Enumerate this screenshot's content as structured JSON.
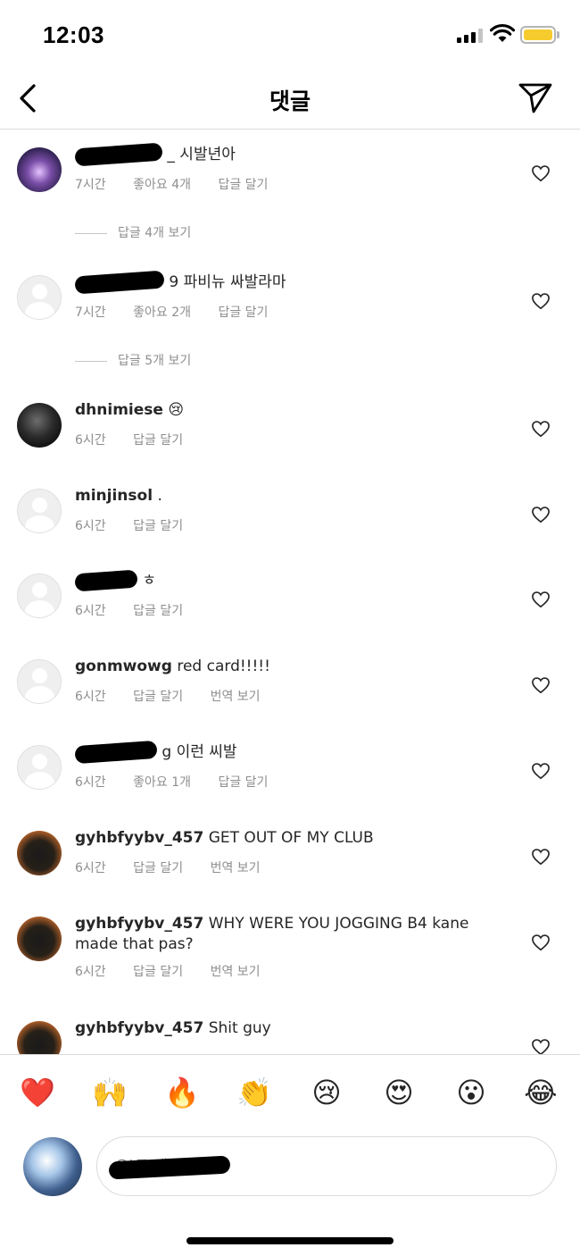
{
  "status_bar": {
    "time": "12:03"
  },
  "header": {
    "title": "댓글"
  },
  "comments": [
    {
      "text": "_ 시발년아",
      "meta": [
        "7시간",
        "좋아요 4개",
        "답글 달기"
      ]
    },
    {
      "replies": "답글 4개 보기"
    },
    {
      "text": "9 파비뉴 싸발라마",
      "meta": [
        "7시간",
        "좋아요 2개",
        "답글 달기"
      ]
    },
    {
      "replies": "답글 5개 보기"
    },
    {
      "user": "dhnimiese",
      "text": "😢",
      "meta": [
        "6시간",
        "답글 달기"
      ]
    },
    {
      "user": "minjinsol",
      "text": ".",
      "meta": [
        "6시간",
        "답글 달기"
      ]
    },
    {
      "text": "ㅎ",
      "meta": [
        "6시간",
        "답글 달기"
      ]
    },
    {
      "user": "gonmwowg",
      "text": "red card!!!!!",
      "meta": [
        "6시간",
        "답글 달기",
        "번역 보기"
      ]
    },
    {
      "text": "g 이런 씨발",
      "meta": [
        "6시간",
        "좋아요 1개",
        "답글 달기"
      ]
    },
    {
      "user": "gyhbfyybv_457",
      "text": "GET OUT OF MY CLUB",
      "meta": [
        "6시간",
        "답글 달기",
        "번역 보기"
      ]
    },
    {
      "user": "gyhbfyybv_457",
      "text": "WHY WERE YOU JOGGING B4 kane made that pas?",
      "meta": [
        "6시간",
        "답글 달기",
        "번역 보기"
      ]
    },
    {
      "user": "gyhbfyybv_457",
      "text": "Shit guy"
    }
  ],
  "emojis": [
    "❤️",
    "🙌",
    "🔥",
    "👏",
    "😢",
    "😍",
    "😮",
    "😂"
  ],
  "input": {
    "placeholder": "으)로 댓글 달기..."
  },
  "icons": {
    "back": "chevron-left-icon",
    "send": "paper-plane-icon",
    "like": "heart-outline-icon"
  },
  "colors": {
    "meta_text": "#8e8e8e",
    "divider": "#dbdbdb",
    "battery": "#f6cb2d"
  }
}
